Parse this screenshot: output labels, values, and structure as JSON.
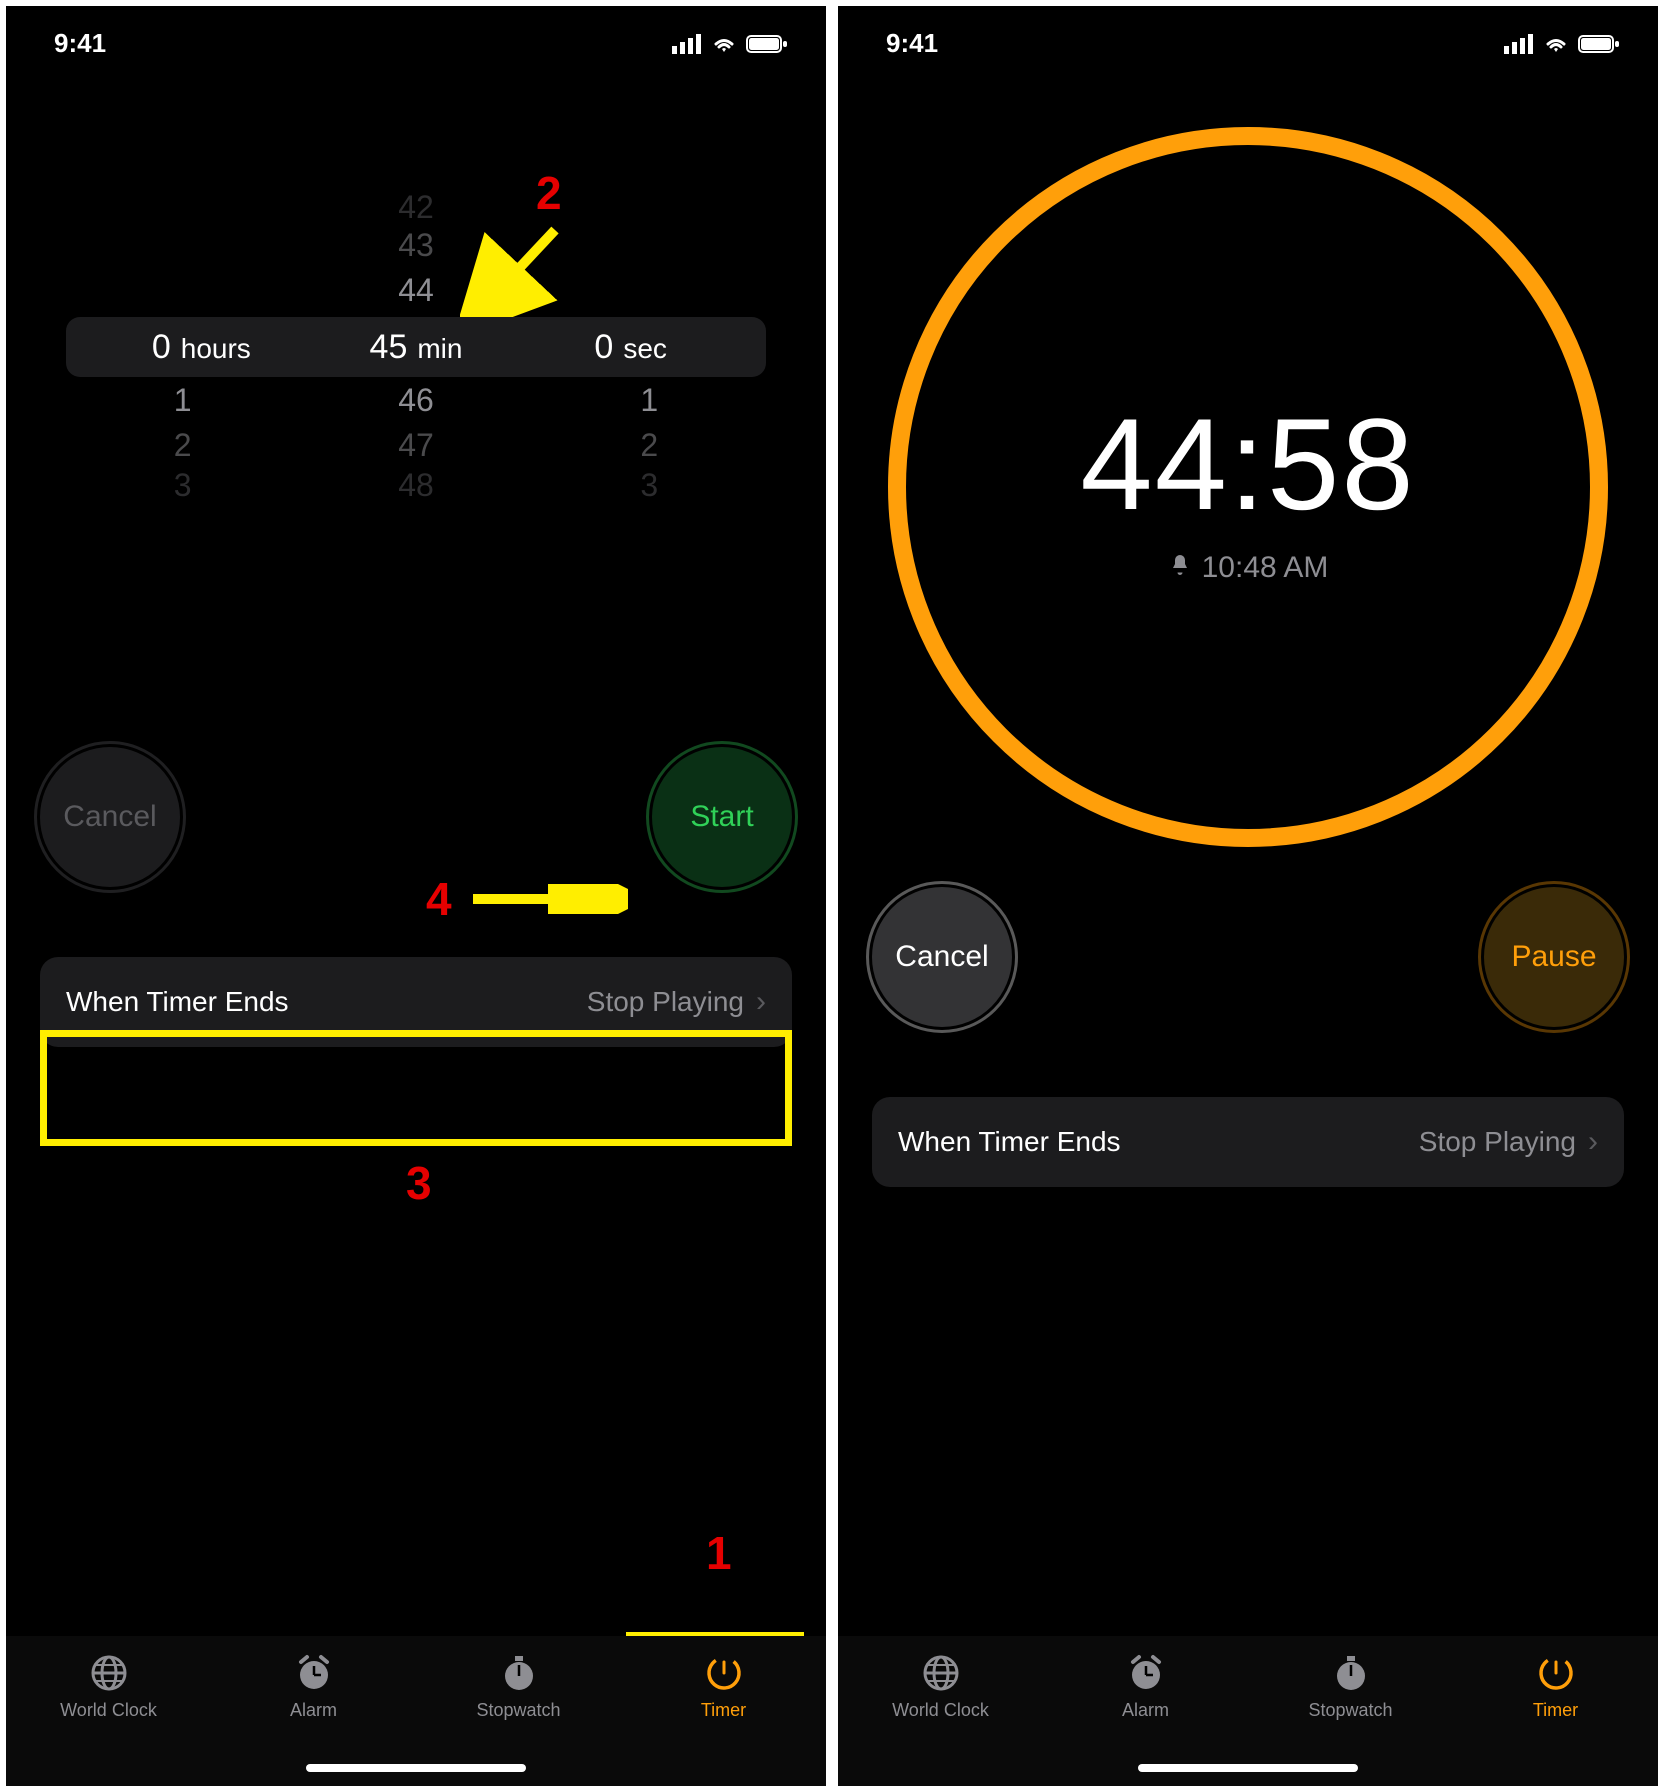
{
  "status": {
    "time": "9:41"
  },
  "picker": {
    "hours": {
      "value": "0",
      "unit": "hours",
      "below": [
        "1",
        "2",
        "3"
      ]
    },
    "minutes": {
      "above": [
        "42",
        "43",
        "44"
      ],
      "value": "45",
      "unit": "min",
      "below": [
        "46",
        "47",
        "48"
      ]
    },
    "seconds": {
      "value": "0",
      "unit": "sec",
      "below": [
        "1",
        "2",
        "3"
      ]
    }
  },
  "buttons": {
    "cancel": "Cancel",
    "start": "Start",
    "pause": "Pause"
  },
  "row": {
    "label": "When Timer Ends",
    "value": "Stop Playing"
  },
  "tabs": {
    "worldclock": "World Clock",
    "alarm": "Alarm",
    "stopwatch": "Stopwatch",
    "timer": "Timer"
  },
  "running": {
    "remaining": "44:58",
    "end_time": "10:48 AM"
  },
  "annotations": {
    "n1": "1",
    "n2": "2",
    "n3": "3",
    "n4": "4"
  }
}
